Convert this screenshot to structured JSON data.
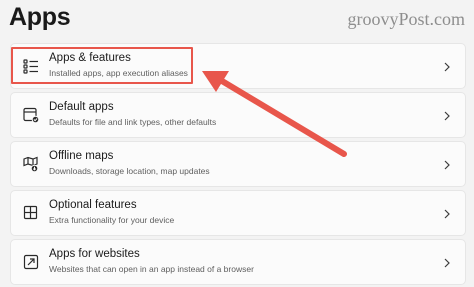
{
  "page": {
    "title": "Apps",
    "watermark": "groovyPost.com"
  },
  "items": [
    {
      "title": "Apps & features",
      "description": "Installed apps, app execution aliases",
      "icon": "apps-list-icon"
    },
    {
      "title": "Default apps",
      "description": "Defaults for file and link types, other defaults",
      "icon": "default-apps-icon"
    },
    {
      "title": "Offline maps",
      "description": "Downloads, storage location, map updates",
      "icon": "offline-map-icon"
    },
    {
      "title": "Optional features",
      "description": "Extra functionality for your device",
      "icon": "optional-features-icon"
    },
    {
      "title": "Apps for websites",
      "description": "Websites that can open in an app instead of a browser",
      "icon": "apps-for-websites-icon"
    }
  ],
  "annotation": {
    "color": "#e8564b"
  }
}
